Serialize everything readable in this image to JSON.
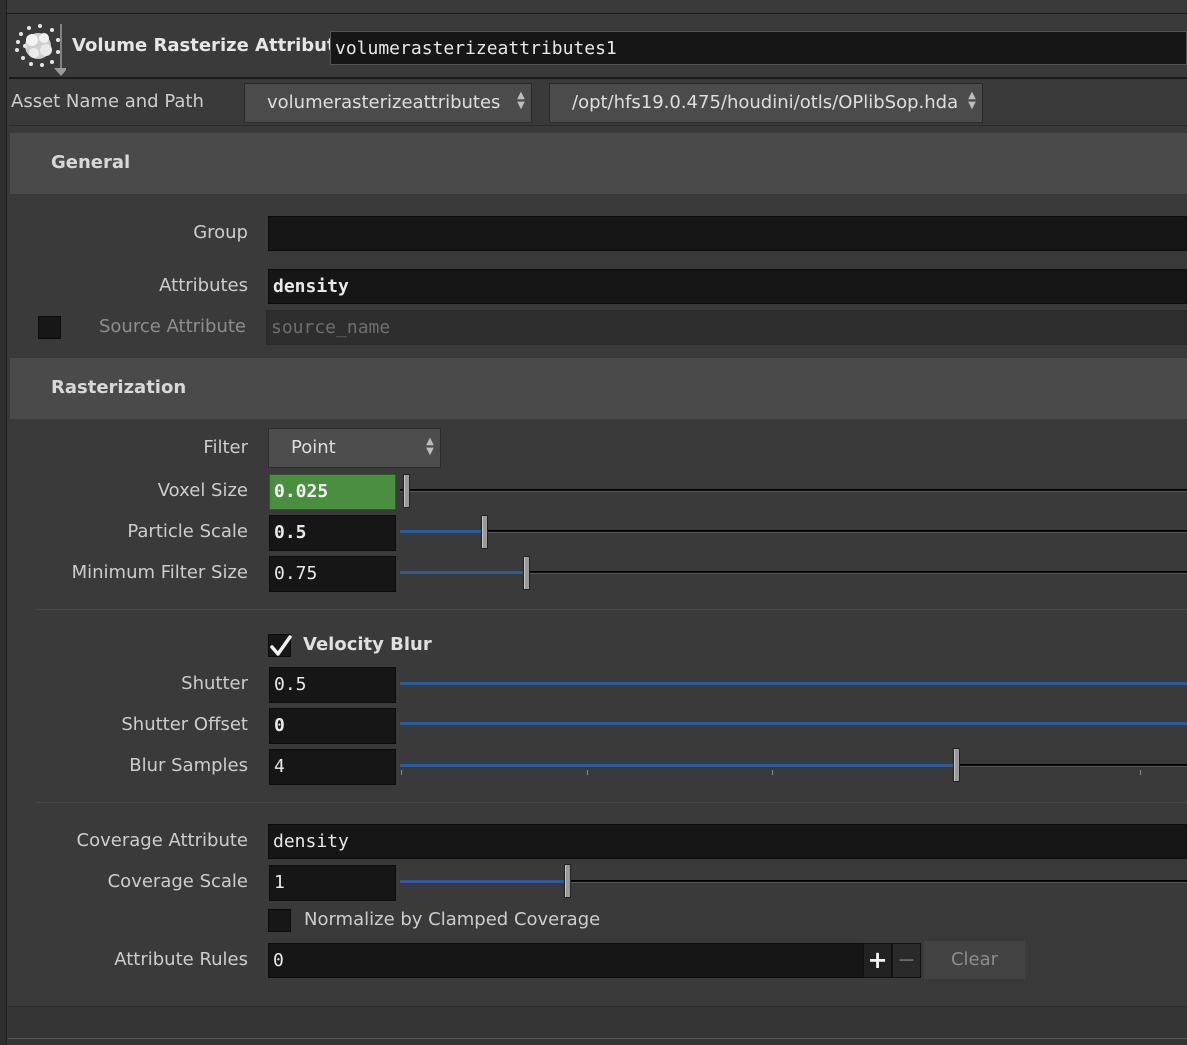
{
  "header": {
    "node_type": "Volume Rasterize Attributes",
    "node_name": "volumerasterizeattributes1"
  },
  "asset": {
    "label": "Asset Name and Path",
    "name": "volumerasterizeattributes",
    "path": "/opt/hfs19.0.475/houdini/otls/OPlibSop.hda"
  },
  "general": {
    "title": "General",
    "group_label": "Group",
    "group_value": "",
    "attributes_label": "Attributes",
    "attributes_value": "density",
    "source_attribute_label": "Source Attribute",
    "source_attribute_placeholder": "source_name",
    "source_attribute_enabled": false
  },
  "rasterization": {
    "title": "Rasterization",
    "filter_label": "Filter",
    "filter_value": "Point",
    "voxel_size_label": "Voxel Size",
    "voxel_size": "0.025",
    "particle_scale_label": "Particle Scale",
    "particle_scale": "0.5",
    "min_filter_size_label": "Minimum Filter Size",
    "min_filter_size": "0.75",
    "velocity_blur_label": "Velocity Blur",
    "velocity_blur": true,
    "shutter_label": "Shutter",
    "shutter": "0.5",
    "shutter_offset_label": "Shutter Offset",
    "shutter_offset": "0",
    "blur_samples_label": "Blur Samples",
    "blur_samples": "4",
    "coverage_attribute_label": "Coverage Attribute",
    "coverage_attribute": "density",
    "coverage_scale_label": "Coverage Scale",
    "coverage_scale": "1",
    "normalize_label": "Normalize by Clamped Coverage",
    "normalize": false,
    "attribute_rules_label": "Attribute Rules",
    "attribute_rules": "0",
    "add_label": "+",
    "remove_label": "−",
    "clear_label": "Clear"
  },
  "colors": {
    "background": "#3a3a3a",
    "field": "#161616",
    "highlight_field": "#4a8f3f",
    "slider_fill": "#2f5a9a"
  },
  "icons": [
    "volume-node-icon",
    "dropdown-arrows-icon",
    "checkmark-icon"
  ]
}
